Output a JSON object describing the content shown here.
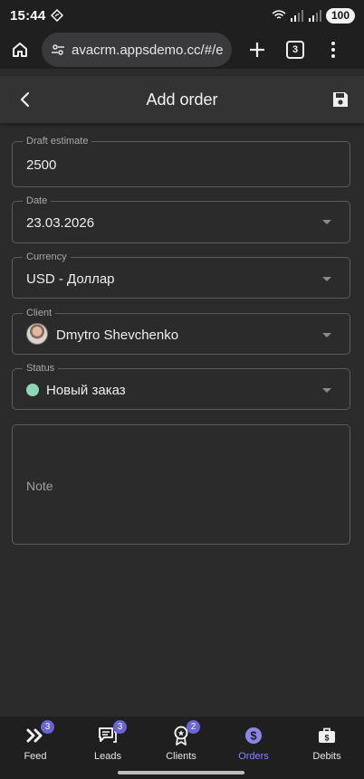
{
  "status_bar": {
    "time": "15:44",
    "battery": "100"
  },
  "browser": {
    "url": "avacrm.appsdemo.cc/#/est",
    "tab_count": "3"
  },
  "header": {
    "title": "Add order"
  },
  "form": {
    "draft_estimate": {
      "label": "Draft estimate",
      "value": "2500"
    },
    "date": {
      "label": "Date",
      "value": "23.03.2026"
    },
    "currency": {
      "label": "Currency",
      "value": "USD - Доллар"
    },
    "client": {
      "label": "Client",
      "value": "Dmytro Shevchenko"
    },
    "status": {
      "label": "Status",
      "value": "Новый заказ",
      "color": "#8fd6b8"
    },
    "note": {
      "placeholder": "Note"
    }
  },
  "bottom_nav": {
    "active_color": "#8c86e8",
    "items": [
      {
        "label": "Feed",
        "icon": "feed-icon",
        "badge": "3"
      },
      {
        "label": "Leads",
        "icon": "leads-chat-icon",
        "badge": "3"
      },
      {
        "label": "Clients",
        "icon": "clients-badge-icon",
        "badge": "2"
      },
      {
        "label": "Orders",
        "icon": "orders-dollar-icon",
        "badge": ""
      },
      {
        "label": "Debits",
        "icon": "debits-briefcase-icon",
        "badge": ""
      }
    ]
  }
}
